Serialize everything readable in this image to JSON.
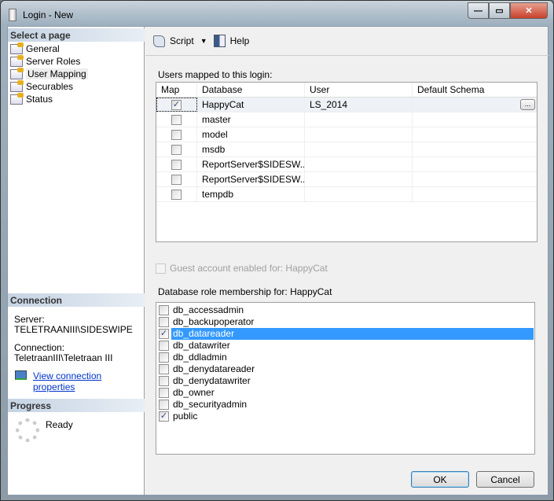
{
  "window": {
    "title": "Login - New",
    "minimize": "—",
    "maximize": "▭",
    "close": "✕"
  },
  "sidebar": {
    "select_header": "Select a page",
    "pages": [
      "General",
      "Server Roles",
      "User Mapping",
      "Securables",
      "Status"
    ],
    "connection_header": "Connection",
    "server_label": "Server:",
    "server_value": "TELETRAANIII\\SIDESWIPE",
    "connection_label": "Connection:",
    "connection_value": "TeletraanIII\\Teletraan III",
    "view_link": "View connection properties",
    "progress_header": "Progress",
    "progress_status": "Ready"
  },
  "toolbar": {
    "script": "Script",
    "help": "Help"
  },
  "mapping": {
    "label": "Users mapped to this login:",
    "columns": [
      "Map",
      "Database",
      "User",
      "Default Schema"
    ],
    "rows": [
      {
        "map": true,
        "database": "HappyCat",
        "user": "LS_2014",
        "schema": ""
      },
      {
        "map": false,
        "database": "master",
        "user": "",
        "schema": ""
      },
      {
        "map": false,
        "database": "model",
        "user": "",
        "schema": ""
      },
      {
        "map": false,
        "database": "msdb",
        "user": "",
        "schema": ""
      },
      {
        "map": false,
        "database": "ReportServer$SIDESW...",
        "user": "",
        "schema": ""
      },
      {
        "map": false,
        "database": "ReportServer$SIDESW...",
        "user": "",
        "schema": ""
      },
      {
        "map": false,
        "database": "tempdb",
        "user": "",
        "schema": ""
      }
    ],
    "browse": "..."
  },
  "guest": {
    "label": "Guest account enabled for: HappyCat",
    "checked": false
  },
  "roles": {
    "label": "Database role membership for: HappyCat",
    "items": [
      {
        "name": "db_accessadmin",
        "checked": false
      },
      {
        "name": "db_backupoperator",
        "checked": false
      },
      {
        "name": "db_datareader",
        "checked": true,
        "selected": true
      },
      {
        "name": "db_datawriter",
        "checked": false
      },
      {
        "name": "db_ddladmin",
        "checked": false
      },
      {
        "name": "db_denydatareader",
        "checked": false
      },
      {
        "name": "db_denydatawriter",
        "checked": false
      },
      {
        "name": "db_owner",
        "checked": false
      },
      {
        "name": "db_securityadmin",
        "checked": false
      },
      {
        "name": "public",
        "checked": true
      }
    ]
  },
  "buttons": {
    "ok": "OK",
    "cancel": "Cancel"
  },
  "colors": {
    "selection": "#3399ff"
  }
}
